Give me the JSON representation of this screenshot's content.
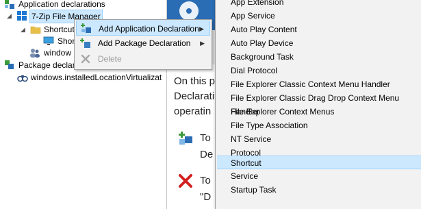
{
  "tree": {
    "items": [
      {
        "label": "Application declarations"
      },
      {
        "label": "7-Zip File Manager"
      },
      {
        "label": "Shortcut"
      },
      {
        "label": "Short"
      },
      {
        "label": "window"
      },
      {
        "label": "Package declarations"
      },
      {
        "label": "windows.installedLocationVirtualizat"
      }
    ]
  },
  "context_menu": {
    "items": [
      {
        "label": "Add Application Declaration",
        "has_submenu": true
      },
      {
        "label": "Add Package Declaration",
        "has_submenu": true
      },
      {
        "label": "Delete",
        "disabled": true
      }
    ]
  },
  "submenu": {
    "items": [
      {
        "label": "App Extension"
      },
      {
        "label": "App Service"
      },
      {
        "label": "Auto Play Content"
      },
      {
        "label": "Auto Play Device"
      },
      {
        "label": "Background Task"
      },
      {
        "label": "Dial Protocol"
      },
      {
        "label": "File Explorer Classic Context Menu Handler"
      },
      {
        "label": "File Explorer Classic Drag Drop Context Menu Handler"
      },
      {
        "label": "File Explorer Context Menus"
      },
      {
        "label": "File Type Association"
      },
      {
        "label": "NT Service"
      },
      {
        "label": "Protocol"
      },
      {
        "label": "Shortcut"
      },
      {
        "label": "Service"
      },
      {
        "label": "Startup Task"
      }
    ]
  },
  "content": {
    "para_line1": "On this p",
    "para_line2": "Declarati",
    "para_line3": "operatin",
    "tip1_line1": "To",
    "tip1_line2": "De",
    "tip2_line1": "To",
    "tip2_line2": "\"D"
  },
  "colors": {
    "selection": "#cce8ff",
    "selection_border": "#99d1ff",
    "header_blue": "#2b6db5",
    "menu_bg": "#f2f2f2"
  },
  "icons": {
    "tree_app_decl": "app-declarations-icon",
    "tree_windows": "windows-logo-icon",
    "tree_folder": "folder-icon",
    "tree_monitor": "monitor-icon",
    "tree_users": "users-icon",
    "tree_package": "package-declarations-icon",
    "tree_binoculars": "binoculars-icon",
    "ctx_add_app": "add-application-icon",
    "ctx_add_pkg": "add-package-icon",
    "ctx_delete": "delete-icon",
    "tip_add": "add-declaration-icon",
    "tip_delete": "delete-x-icon"
  }
}
